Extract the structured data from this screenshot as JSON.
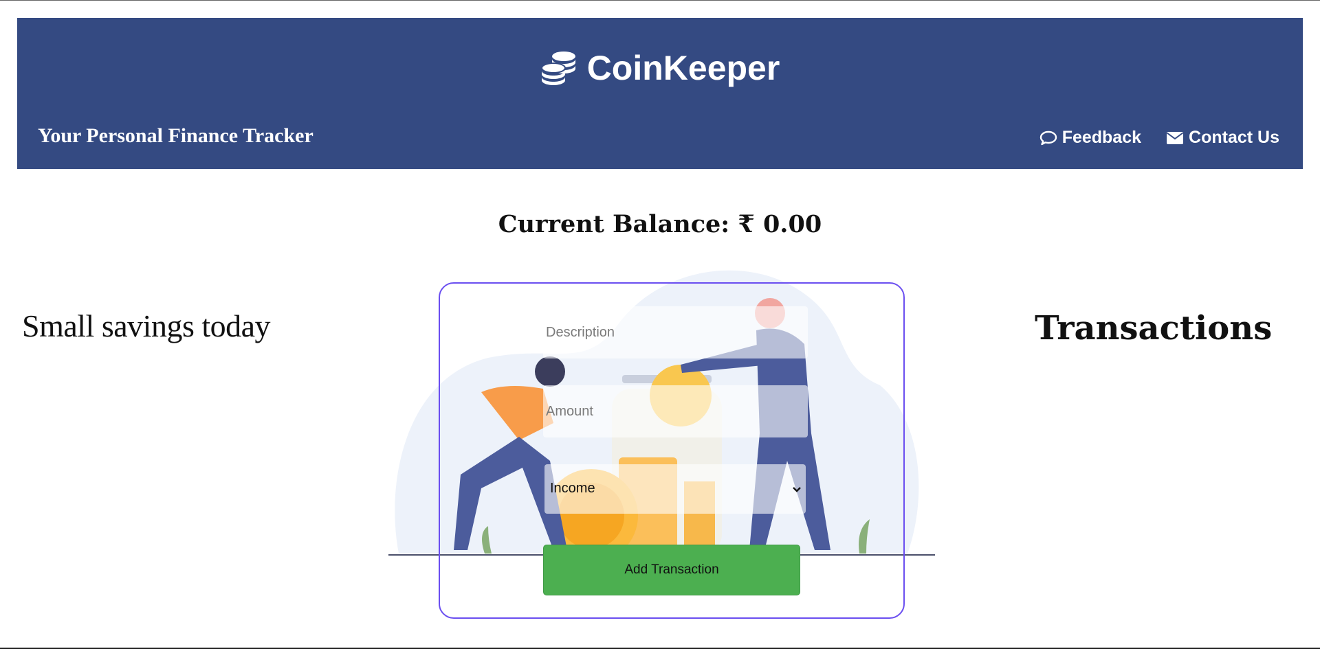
{
  "header": {
    "brand": {
      "title": "CoinKeeper",
      "icon": "coins-icon"
    },
    "tagline": "Your Personal Finance Tracker",
    "nav": [
      {
        "label": "Feedback",
        "icon": "comment-icon"
      },
      {
        "label": "Contact Us",
        "icon": "envelope-icon"
      }
    ],
    "background_color": "#344a82"
  },
  "balance": {
    "label": "Current Balance: ₹ 0.00"
  },
  "left_panel": {
    "heading": "Small savings today"
  },
  "right_panel": {
    "heading": "Transactions"
  },
  "form": {
    "description": {
      "placeholder": "Description",
      "value": ""
    },
    "amount": {
      "placeholder": "Amount",
      "value": ""
    },
    "type": {
      "selected": "Income"
    },
    "submit_label": "Add Transaction",
    "border_color": "#6a4ef0",
    "button_color": "#4caf50"
  },
  "illustration": {
    "name": "savings-illustration"
  }
}
